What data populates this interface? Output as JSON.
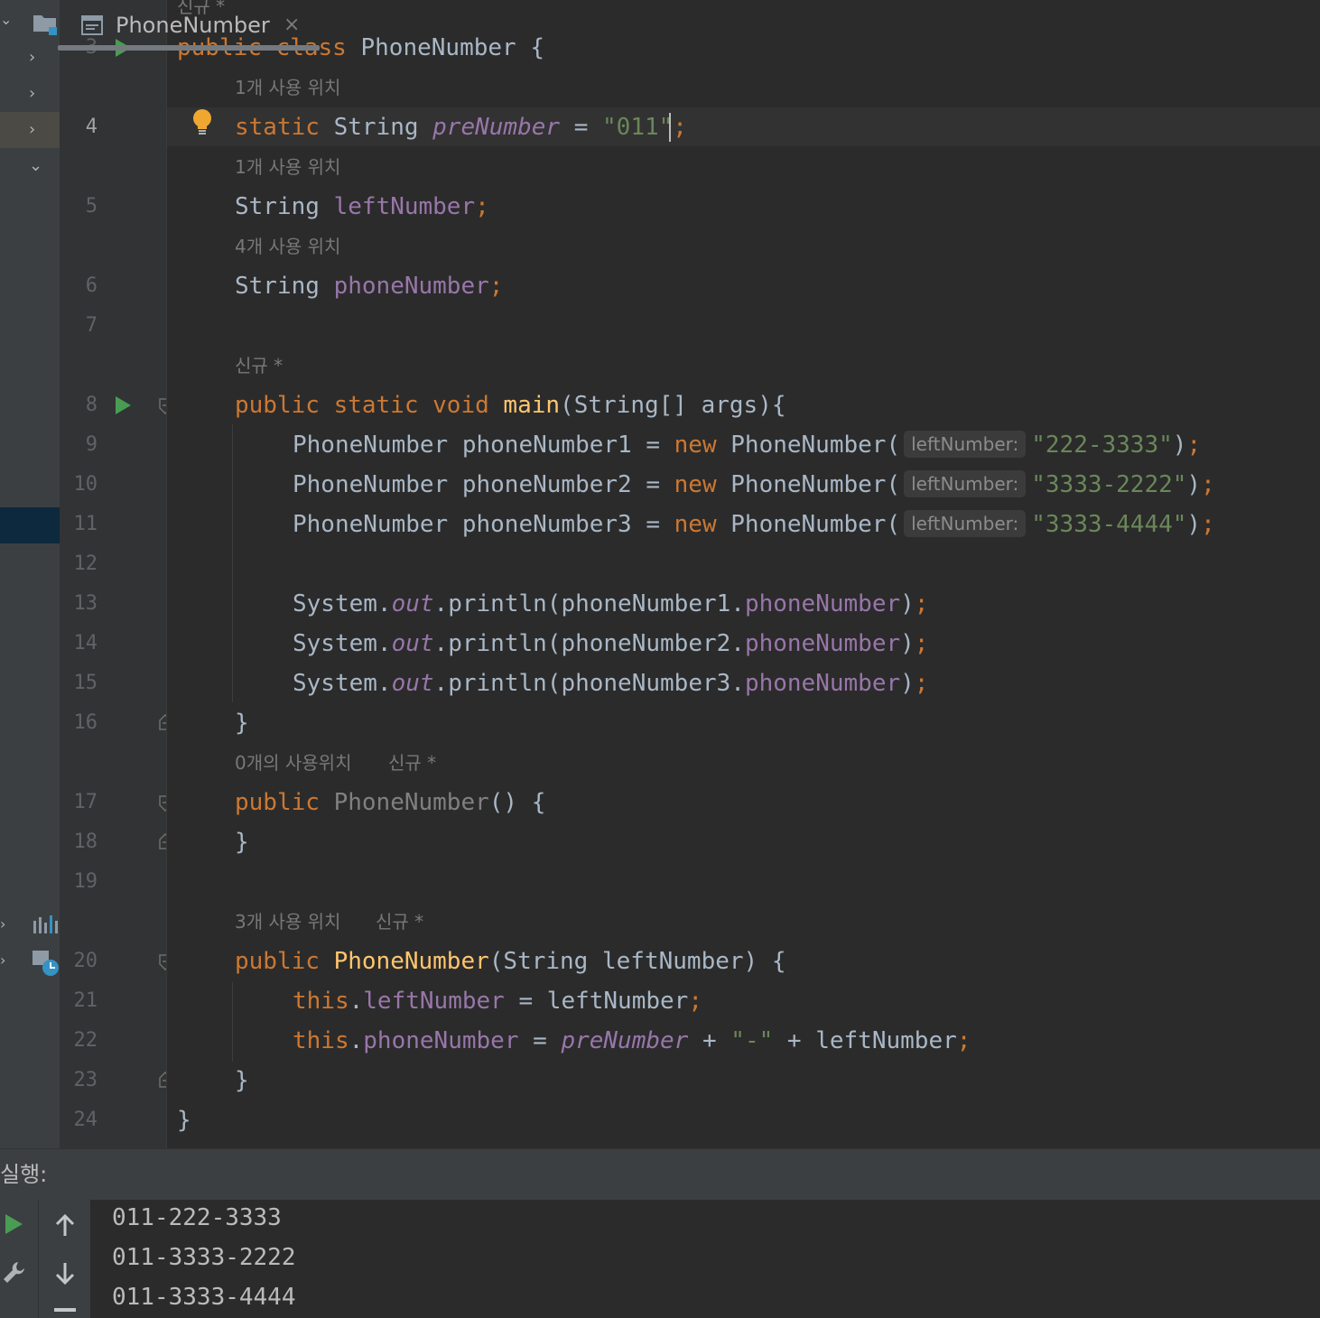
{
  "editor": {
    "hint_top": "신규 *",
    "lines": [
      {
        "num": "3"
      },
      {
        "num": "4"
      },
      {
        "num": "5"
      },
      {
        "num": "6"
      },
      {
        "num": "7"
      },
      {
        "num": "8"
      },
      {
        "num": "9"
      },
      {
        "num": "10"
      },
      {
        "num": "11"
      },
      {
        "num": "12"
      },
      {
        "num": "13"
      },
      {
        "num": "14"
      },
      {
        "num": "15"
      },
      {
        "num": "16"
      },
      {
        "num": "17"
      },
      {
        "num": "18"
      },
      {
        "num": "19"
      },
      {
        "num": "20"
      },
      {
        "num": "21"
      },
      {
        "num": "22"
      },
      {
        "num": "23"
      },
      {
        "num": "24"
      }
    ],
    "hints": {
      "prenumber_usages": "1개 사용 위치",
      "leftnumber_usages": "1개 사용 위치",
      "phonenumber_usages": "4개 사용 위치",
      "main_new": "신규 *",
      "ctor0_usages": "0개의 사용위치",
      "ctor0_new": "신규 *",
      "ctor1_usages": "3개 사용 위치",
      "ctor1_new": "신규 *"
    },
    "param_hint": "leftNumber:",
    "code": {
      "l3_kw": "public class ",
      "l3_name": "PhoneNumber",
      "l3_rest": " {",
      "l4_kw": "static ",
      "l4_type": "String ",
      "l4_field": "preNumber",
      "l4_eq": " = ",
      "l4_str": "\"011\"",
      "l4_semi": ";",
      "l5_type": "String ",
      "l5_field": "leftNumber",
      "l5_semi": ";",
      "l6_type": "String ",
      "l6_field": "phoneNumber",
      "l6_semi": ";",
      "l8_kw": "public static void ",
      "l8_fn": "main",
      "l8_rest": "(String[] args){",
      "l9_a": "PhoneNumber phoneNumber1 = ",
      "l9_str": "\"222-3333\"",
      "l10_a": "PhoneNumber phoneNumber2 = ",
      "l10_str": "\"3333-2222\"",
      "l11_a": "PhoneNumber phoneNumber3 = ",
      "l11_str": "\"3333-4444\"",
      "new_kw": "new ",
      "ctor_call": "PhoneNumber(",
      "close_call": ")",
      "semi": ";",
      "sys": "System.",
      "out": "out",
      "println": ".println(",
      "l13_arg": "phoneNumber1.",
      "l14_arg": "phoneNumber2.",
      "l15_arg": "phoneNumber3.",
      "field_phone": "phoneNumber",
      "close_paren": ")",
      "brace_close": "}",
      "l17_kw": "public ",
      "l17_name": "PhoneNumber",
      "l17_rest": "() {",
      "l20_kw": "public ",
      "l20_fn": "PhoneNumber",
      "l20_rest": "(String leftNumber) {",
      "this_kw": "this",
      "dot": ".",
      "l21_field": "leftNumber",
      "l21_rest": " = leftNumber",
      "l22_field": "phoneNumber",
      "l22_eq": " = ",
      "l22_pre": "preNumber",
      "l22_plus1": " + ",
      "l22_str": "\"-\"",
      "l22_plus2": " + leftNumber"
    }
  },
  "run_panel": {
    "label": "실행:",
    "tab_title": "PhoneNumber",
    "close_glyph": "×",
    "output": [
      "011-222-3333",
      "011-3333-2222",
      "011-3333-4444"
    ]
  },
  "colors": {
    "keyword": "#cc7832",
    "field": "#9876aa",
    "string": "#6a8759",
    "function": "#ffc66d",
    "run_green": "#499c54",
    "background": "#2b2b2b"
  },
  "icons": [
    "folder-icon",
    "run-icon",
    "bulb-icon",
    "fold-icon",
    "console-icon",
    "rerun-icon",
    "wrench-icon",
    "up-arrow-icon",
    "down-arrow-icon",
    "close-icon"
  ]
}
